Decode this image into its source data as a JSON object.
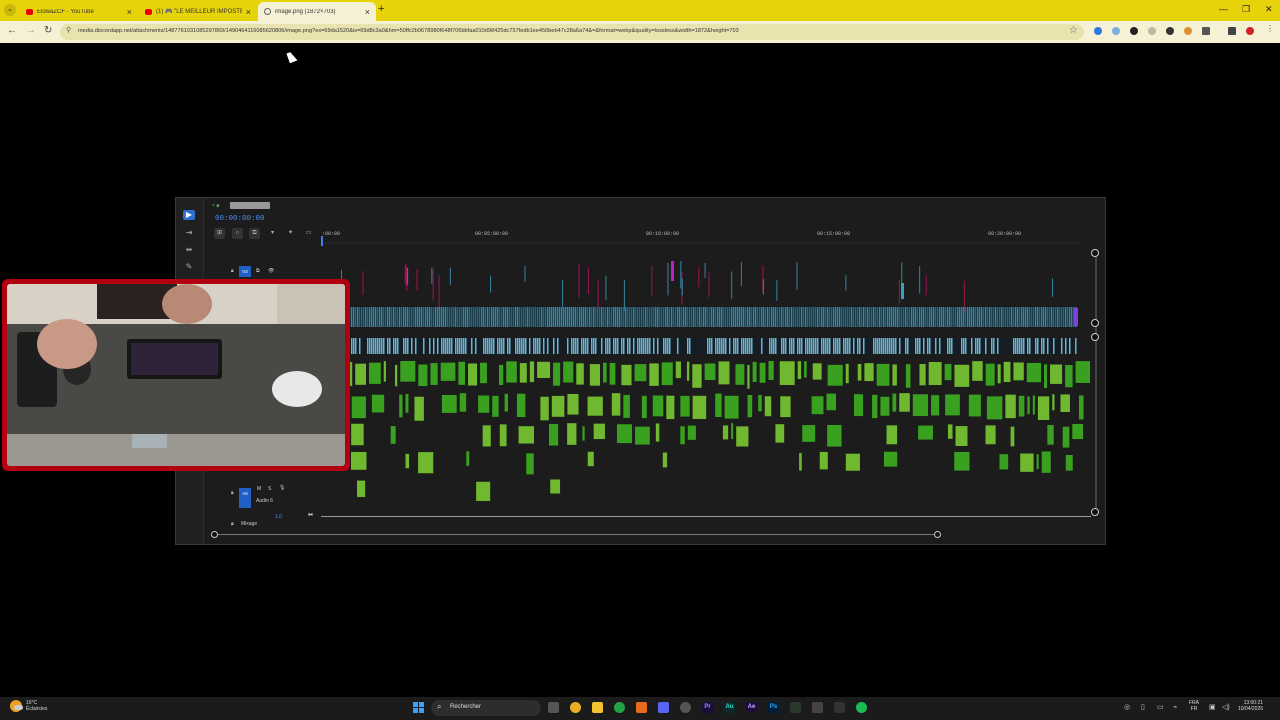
{
  "browser": {
    "tabs": [
      {
        "label": "ElowaZCF - YouTube",
        "favicon": "youtube-icon",
        "active": false
      },
      {
        "label": "(1) 🎮 \"LE MEILLEUR IMPOSTE...",
        "favicon": "youtube-icon",
        "active": false
      },
      {
        "label": "image.png (1872×703)",
        "favicon": "page-icon",
        "active": true
      }
    ],
    "url": "media.discordapp.net/attachments/1487761031085297869/1490464116085620806/image.png?ex=69da1520&is=69d8c3a0&hm=50ffc2b0678980f648f706bbfaa010d98425dc757fedb1ee450beb47c28a6a74&=&format=webp&quality=lossless&width=1872&height=703",
    "accent": "#e6d30a"
  },
  "timeline": {
    "timecode": "00:00:00:00",
    "ruler_labels": [
      ":00:00",
      "00:05:00:00",
      "00:10:00:00",
      "00:15:00:00",
      "00:20:00:00"
    ],
    "tracks": {
      "v3": "V3",
      "a6_badge": "A6",
      "a6_name": "Audio 6",
      "mix_name": "Mixage",
      "mix_value": "1,0"
    }
  },
  "taskbar": {
    "weather_temp": "16°C",
    "weather_desc": "Éclaircies",
    "search_placeholder": "Rechercher",
    "lang_top": "FRA",
    "lang_bottom": "FR",
    "time": "13:00:21",
    "date": "10/04/2026"
  }
}
